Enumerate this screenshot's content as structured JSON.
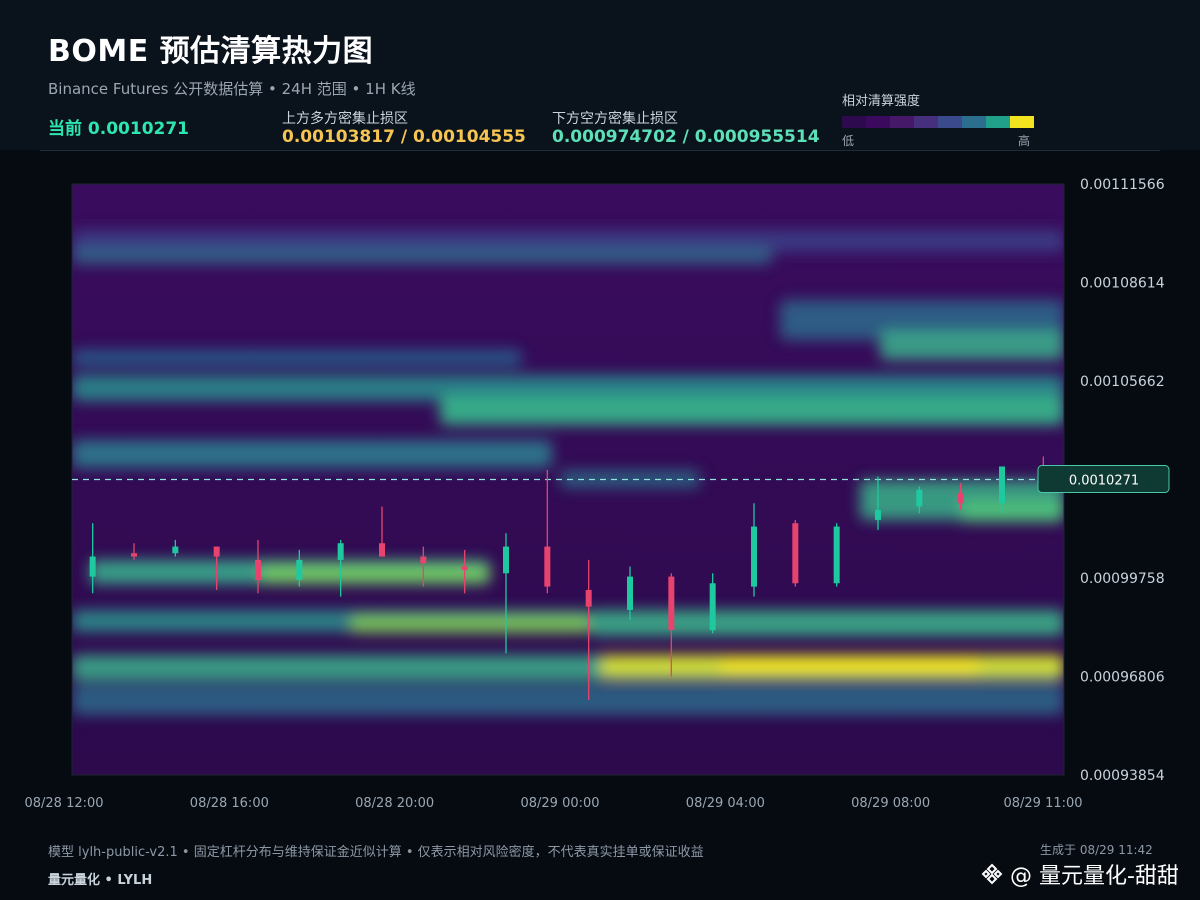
{
  "header": {
    "title": "BOME 预估清算热力图",
    "subtitle": "Binance Futures 公开数据估算 • 24H 范围 • 1H K线",
    "current_label": "当前 0.0010271",
    "upper_label": "上方多方密集止损区",
    "upper_value": "0.00103817 / 0.00104555",
    "lower_label": "下方空方密集止损区",
    "lower_value": "0.000974702 / 0.000955514"
  },
  "legend": {
    "title": "相对清算强度",
    "low": "低",
    "high": "高",
    "colors": [
      "#2d0a4e",
      "#3b0a5e",
      "#451868",
      "#46307e",
      "#3b4a8c",
      "#2c6e8e",
      "#21a08a",
      "#f2e41e"
    ]
  },
  "colors": {
    "up": "#1fc9a0",
    "down": "#e8436f",
    "current_line": "#8fe3d8",
    "upper_value": "#f5c451",
    "lower_value": "#5de0b8"
  },
  "chart_data": {
    "type": "heatmap",
    "x_ticks": [
      "08/28 12:00",
      "08/28 16:00",
      "08/28 20:00",
      "08/29 00:00",
      "08/29 04:00",
      "08/29 08:00",
      "08/29 11:00"
    ],
    "y_ticks": [
      "0.00111566",
      "0.00108614",
      "0.00105662",
      "0.00099758",
      "0.00096806",
      "0.00093854"
    ],
    "ylim": [
      0.00093854,
      0.00111566
    ],
    "current_price": 0.0010271,
    "current_price_label": "0.0010271",
    "candles": [
      {
        "t": 0,
        "o": 0.000998,
        "h": 0.001014,
        "l": 0.000993,
        "c": 0.001004
      },
      {
        "t": 1,
        "o": 0.001005,
        "h": 0.001008,
        "l": 0.001003,
        "c": 0.001004
      },
      {
        "t": 2,
        "o": 0.001005,
        "h": 0.001009,
        "l": 0.001004,
        "c": 0.001007
      },
      {
        "t": 3,
        "o": 0.001007,
        "h": 0.001007,
        "l": 0.000994,
        "c": 0.001004
      },
      {
        "t": 4,
        "o": 0.001003,
        "h": 0.001009,
        "l": 0.000993,
        "c": 0.000997
      },
      {
        "t": 5,
        "o": 0.000997,
        "h": 0.001006,
        "l": 0.000995,
        "c": 0.001003
      },
      {
        "t": 6,
        "o": 0.001003,
        "h": 0.001009,
        "l": 0.000992,
        "c": 0.001008
      },
      {
        "t": 7,
        "o": 0.001008,
        "h": 0.001019,
        "l": 0.001004,
        "c": 0.001004
      },
      {
        "t": 8,
        "o": 0.001004,
        "h": 0.001007,
        "l": 0.000995,
        "c": 0.001002
      },
      {
        "t": 9,
        "o": 0.001001,
        "h": 0.001006,
        "l": 0.000993,
        "c": 0.001
      },
      {
        "t": 10,
        "o": 0.000999,
        "h": 0.001011,
        "l": 0.000975,
        "c": 0.001007
      },
      {
        "t": 11,
        "o": 0.001007,
        "h": 0.00103,
        "l": 0.000993,
        "c": 0.000995
      },
      {
        "t": 12,
        "o": 0.000994,
        "h": 0.001003,
        "l": 0.000961,
        "c": 0.000989
      },
      {
        "t": 13,
        "o": 0.000988,
        "h": 0.001001,
        "l": 0.000985,
        "c": 0.000998
      },
      {
        "t": 14,
        "o": 0.000998,
        "h": 0.000999,
        "l": 0.000968,
        "c": 0.000982
      },
      {
        "t": 15,
        "o": 0.000982,
        "h": 0.000999,
        "l": 0.000981,
        "c": 0.000996
      },
      {
        "t": 16,
        "o": 0.000995,
        "h": 0.00102,
        "l": 0.000992,
        "c": 0.001013
      },
      {
        "t": 17,
        "o": 0.001014,
        "h": 0.001015,
        "l": 0.000995,
        "c": 0.000996
      },
      {
        "t": 18,
        "o": 0.000996,
        "h": 0.001014,
        "l": 0.000995,
        "c": 0.001013
      },
      {
        "t": 19,
        "o": 0.001015,
        "h": 0.001028,
        "l": 0.001012,
        "c": 0.001018
      },
      {
        "t": 20,
        "o": 0.001019,
        "h": 0.001025,
        "l": 0.001017,
        "c": 0.001024
      },
      {
        "t": 21,
        "o": 0.001023,
        "h": 0.001026,
        "l": 0.001018,
        "c": 0.00102
      },
      {
        "t": 22,
        "o": 0.00102,
        "h": 0.00103,
        "l": 0.001017,
        "c": 0.001031
      },
      {
        "t": 23,
        "o": 0.001031,
        "h": 0.001034,
        "l": 0.001028,
        "c": 0.00103
      }
    ]
  },
  "footer": {
    "model": "模型 lylh-public-v2.1 • 固定杠杆分布与维持保证金近似计算 • 仅表示相对风险密度，不代表真实挂单或保证收益",
    "brand": "量元量化 • LYLH",
    "generated": "生成于 08/29 11:42",
    "watermark": "@ 量元量化-甜甜"
  }
}
